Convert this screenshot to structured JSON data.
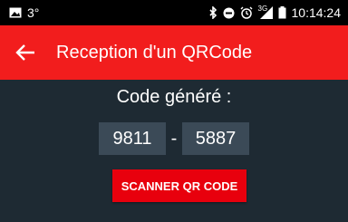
{
  "status_bar": {
    "temperature": "3°",
    "network_type": "3G",
    "time": "10:14:24",
    "icons": [
      "image-icon",
      "bluetooth-icon",
      "do-not-disturb-icon",
      "alarm-icon",
      "signal-icon",
      "battery-icon"
    ]
  },
  "app_bar": {
    "title": "Reception d'un QRCode",
    "color": "#f21d1d"
  },
  "main": {
    "label": "Code généré :",
    "code_part1": "9811",
    "separator": "-",
    "code_part2": "5887",
    "scan_button_label": "SCANNER QR CODE",
    "button_color": "#e8000d",
    "background_color": "#1e2a33"
  }
}
